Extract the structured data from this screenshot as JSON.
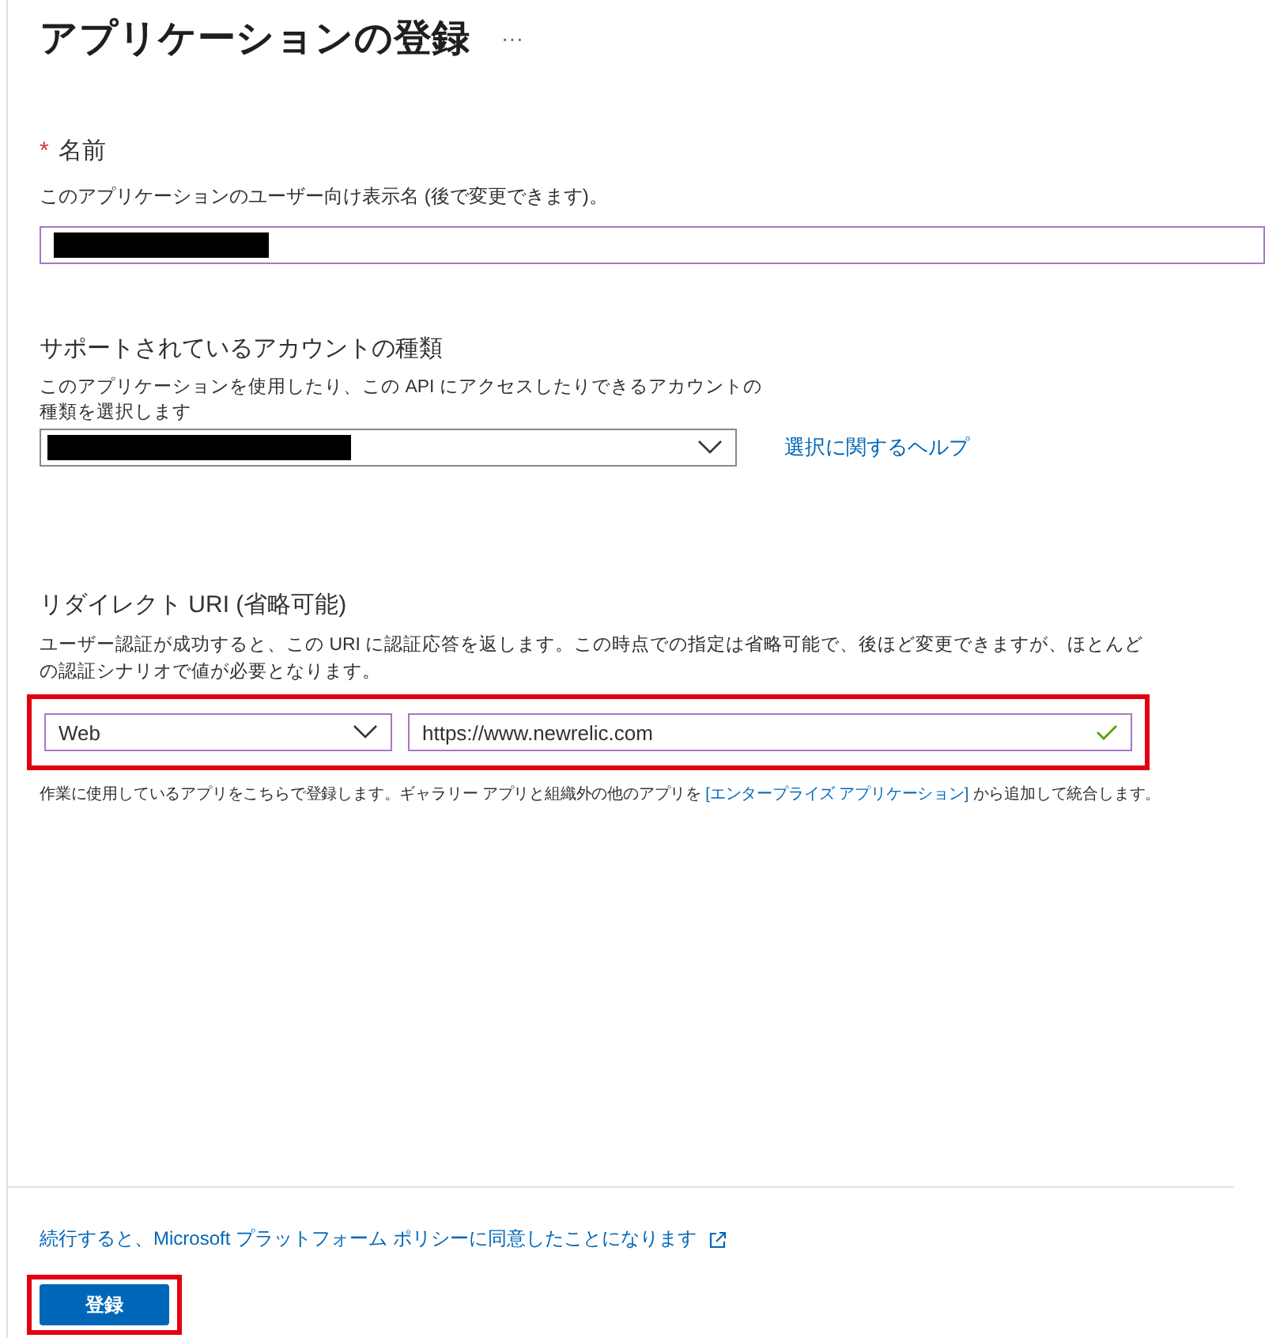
{
  "title": "アプリケーションの登録",
  "more": "···",
  "name_field": {
    "label": "名前",
    "required_mark": "*",
    "description": "このアプリケーションのユーザー向け表示名 (後で変更できます)。",
    "redacted": true
  },
  "account_types": {
    "heading": "サポートされているアカウントの種類",
    "description": "このアプリケーションを使用したり、この API にアクセスしたりできるアカウントの種類を選択します",
    "redacted": true,
    "help_link": "選択に関するヘルプ"
  },
  "redirect_uri": {
    "heading": "リダイレクト URI (省略可能)",
    "description": "ユーザー認証が成功すると、この URI に認証応答を返します。この時点での指定は省略可能で、後ほど変更できますが、ほとんどの認証シナリオで値が必要となります。",
    "highlighted": true,
    "platform": "Web",
    "value": "https://www.newrelic.com",
    "valid": true
  },
  "note": {
    "before": "作業に使用しているアプリをこちらで登録します。ギャラリー アプリと組織外の他のアプリを ",
    "link": "[エンタープライズ アプリケーション]",
    "after": " から追加して統合します。"
  },
  "policy_link": "続行すると、Microsoft プラットフォーム ポリシーに同意したことになります",
  "register_button": {
    "label": "登録",
    "highlighted": true
  }
}
